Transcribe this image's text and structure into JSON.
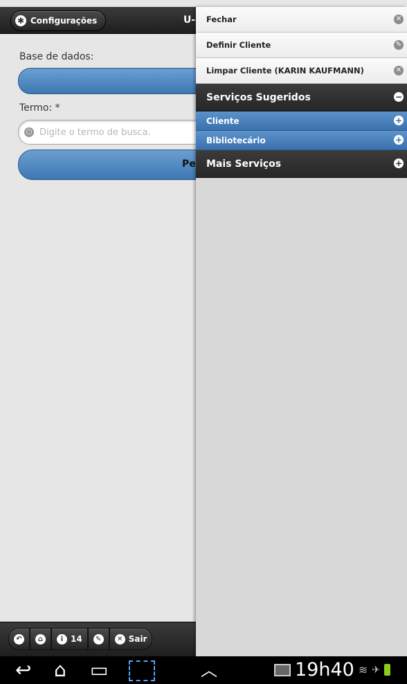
{
  "header": {
    "settings_label": "Configurações",
    "title": "U-"
  },
  "form": {
    "database_label": "Base de dados:",
    "term_label": "Termo: *",
    "search_placeholder": "Digite o termo de busca.",
    "search_button_label": "Pe"
  },
  "panel": {
    "items": [
      {
        "label": "Fechar",
        "icon": "close-circle-icon"
      },
      {
        "label": "Definir Cliente",
        "icon": "pencil-icon"
      },
      {
        "label": "Limpar Cliente (KARIN KAUFMANN)",
        "icon": "close-circle-icon"
      }
    ],
    "suggested_header": "Serviços Sugeridos",
    "suggested_items": [
      {
        "label": "Cliente"
      },
      {
        "label": "Bibliotecário"
      }
    ],
    "more_header": "Mais Serviços"
  },
  "footer": {
    "badge_count": "14",
    "exit_label": "Sair"
  },
  "system": {
    "clock": "19h40"
  },
  "colors": {
    "accent_blue": "#3e77b3",
    "header_dark": "#262626",
    "battery": "#8acd1a"
  }
}
